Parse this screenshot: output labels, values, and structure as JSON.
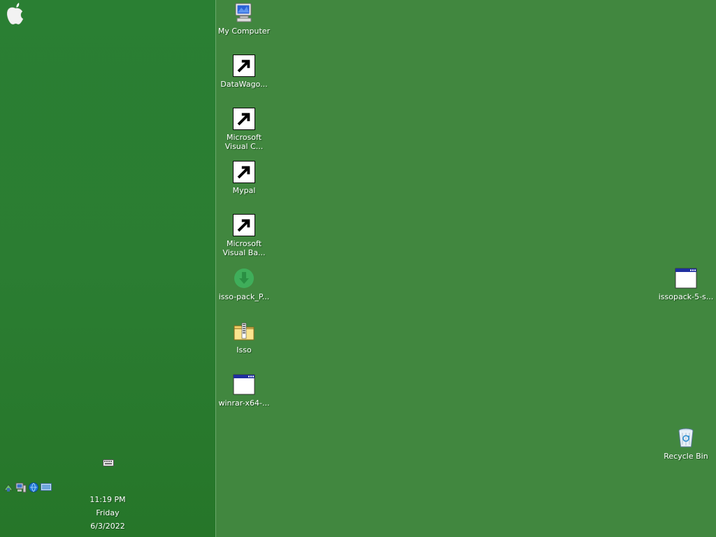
{
  "sidebar": {
    "logo_icon": "apple-icon",
    "keyboard_icon": "keyboard-icon",
    "tray_icons": [
      "network-icon",
      "computer-icon",
      "globe-icon",
      "monitor-icon"
    ],
    "clock": {
      "time": "11:19 PM",
      "day": "Friday",
      "date": "6/3/2022"
    }
  },
  "desktop": {
    "background_color": "#41873f",
    "icons": [
      {
        "label": "My Computer",
        "icon": "computer-icon"
      },
      {
        "label": "DataWago...",
        "icon": "datawagon-icon"
      },
      {
        "label": "Microsoft Visual C...",
        "icon": "visual-cpp-icon"
      },
      {
        "label": "Mypal",
        "icon": "mypal-browser-icon"
      },
      {
        "label": "Microsoft Visual Ba...",
        "icon": "visual-basic-icon"
      },
      {
        "label": "isso-pack_P...",
        "icon": "download-arrow-icon"
      },
      {
        "label": "Isso",
        "icon": "zip-folder-icon"
      },
      {
        "label": "winrar-x64-...",
        "icon": "application-window-icon"
      },
      {
        "label": "issopack-5-s...",
        "icon": "application-window-icon"
      },
      {
        "label": "Recycle Bin",
        "icon": "recycle-bin-icon"
      }
    ]
  }
}
